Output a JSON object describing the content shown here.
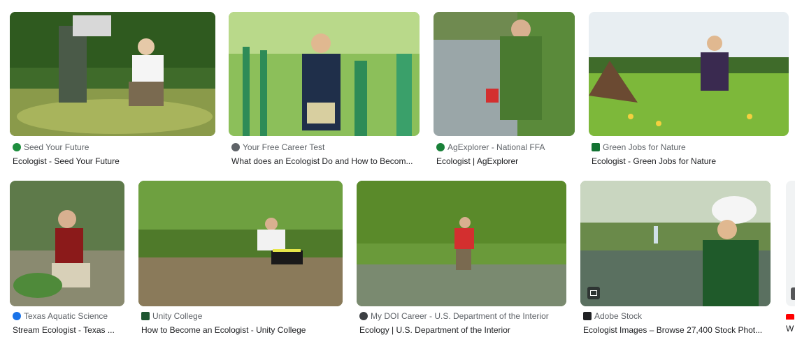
{
  "results": [
    {
      "source": "Seed Your Future",
      "title": "Ecologist - Seed Your Future",
      "favicon_color": "#1e8e3e"
    },
    {
      "source": "Your Free Career Test",
      "title": "What does an Ecologist Do and How to Becom...",
      "favicon_color": "#5f6368"
    },
    {
      "source": "AgExplorer - National FFA",
      "title": "Ecologist | AgExplorer",
      "favicon_color": "#188038"
    },
    {
      "source": "Green Jobs for Nature",
      "title": "Ecologist - Green Jobs for Nature",
      "favicon_color": "#137333"
    },
    {
      "source": "Texas Aquatic Science",
      "title": "Stream Ecologist - Texas ...",
      "favicon_color": "#1a73e8"
    },
    {
      "source": "Unity College",
      "title": "How to Become an Ecologist - Unity College",
      "favicon_color": "#1e5631"
    },
    {
      "source": "My DOI Career - U.S. Department of the Interior",
      "title": "Ecology | U.S. Department of the Interior",
      "favicon_color": "#3c4043"
    },
    {
      "source": "Adobe Stock",
      "title": "Ecologist Images – Browse 27,400 Stock Phot...",
      "favicon_color": "#202124"
    },
    {
      "source": "",
      "title": "W",
      "favicon_color": "#ff0000"
    }
  ]
}
